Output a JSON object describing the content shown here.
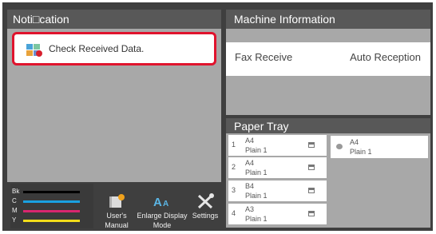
{
  "notification": {
    "title": "Noti□cation",
    "message": "Check Received Data."
  },
  "machine_info": {
    "title": "Machine Information",
    "label": "Fax Receive",
    "value": "Auto Reception"
  },
  "paper_tray": {
    "title": "Paper Tray",
    "trays": [
      {
        "num": "1",
        "size": "A4",
        "type": "Plain 1"
      },
      {
        "num": "2",
        "size": "A4",
        "type": "Plain 1"
      },
      {
        "num": "3",
        "size": "B4",
        "type": "Plain 1"
      },
      {
        "num": "4",
        "size": "A3",
        "type": "Plain 1"
      }
    ],
    "bypass": {
      "size": "A4",
      "type": "Plain 1"
    }
  },
  "toner": {
    "levels": [
      {
        "label": "Bk",
        "color": "#000000",
        "level": 0.85
      },
      {
        "label": "C",
        "color": "#1aa0e0",
        "level": 0.85
      },
      {
        "label": "M",
        "color": "#d8266f",
        "level": 0.85
      },
      {
        "label": "Y",
        "color": "#f2dc1a",
        "level": 0.85
      }
    ]
  },
  "buttons": {
    "manual_line1": "User's",
    "manual_line2": "Manual",
    "enlarge_line1": "Enlarge Display",
    "enlarge_line2": "Mode",
    "settings": "Settings"
  }
}
